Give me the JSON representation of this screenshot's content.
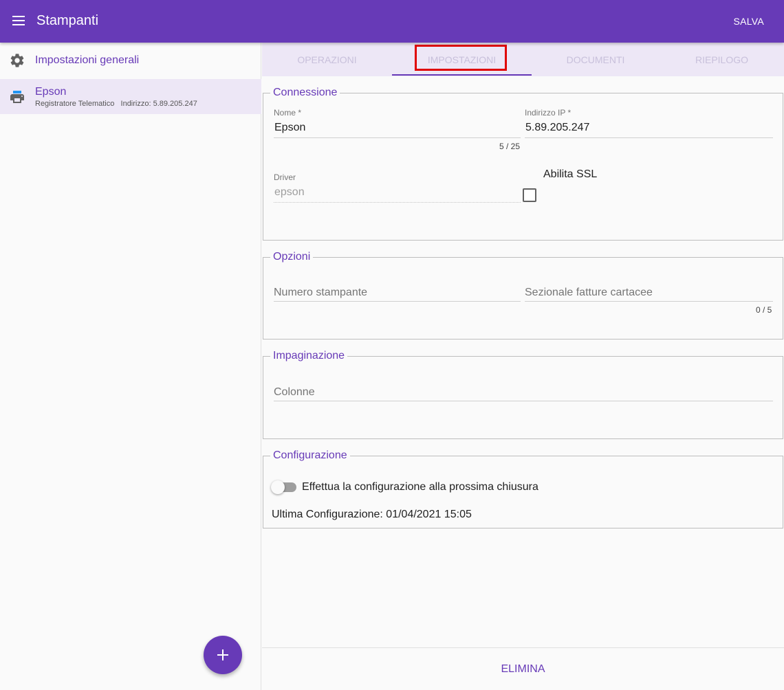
{
  "appbar": {
    "title": "Stampanti",
    "save_label": "SALVA"
  },
  "sidebar": {
    "items": [
      {
        "label": "Impostazioni generali",
        "icon": "gear-icon"
      },
      {
        "label": "Epson",
        "subtitle": "Registratore Telematico   Indirizzo: 5.89.205.247",
        "icon": "printer-icon",
        "selected": true
      }
    ],
    "fab_icon": "plus-icon"
  },
  "tabs": [
    {
      "label": "OPERAZIONI"
    },
    {
      "label": "IMPOSTAZIONI",
      "active": true
    },
    {
      "label": "DOCUMENTI"
    },
    {
      "label": "RIEPILOGO"
    }
  ],
  "connessione": {
    "title": "Connessione",
    "nome_label": "Nome *",
    "nome_value": "Epson",
    "nome_counter": "5 / 25",
    "ip_label": "Indirizzo IP *",
    "ip_value": "5.89.205.247",
    "driver_label": "Driver",
    "driver_value": "epson",
    "ssl_label": "Abilita SSL",
    "ssl_checked": false
  },
  "opzioni": {
    "title": "Opzioni",
    "numero_placeholder": "Numero stampante",
    "sezionale_placeholder": "Sezionale fatture cartacee",
    "sezionale_counter": "0 / 5"
  },
  "impaginazione": {
    "title": "Impaginazione",
    "colonne_placeholder": "Colonne"
  },
  "configurazione": {
    "title": "Configurazione",
    "toggle_label": "Effettua la configurazione alla prossima chiusura",
    "toggle_on": false,
    "last_config": "Ultima Configurazione: 01/04/2021 15:05"
  },
  "footer": {
    "delete_label": "ELIMINA"
  },
  "colors": {
    "primary": "#673ab7",
    "tab_bg": "#ede7f6",
    "highlight": "#e00000",
    "printer_accent": "#2196f3"
  }
}
